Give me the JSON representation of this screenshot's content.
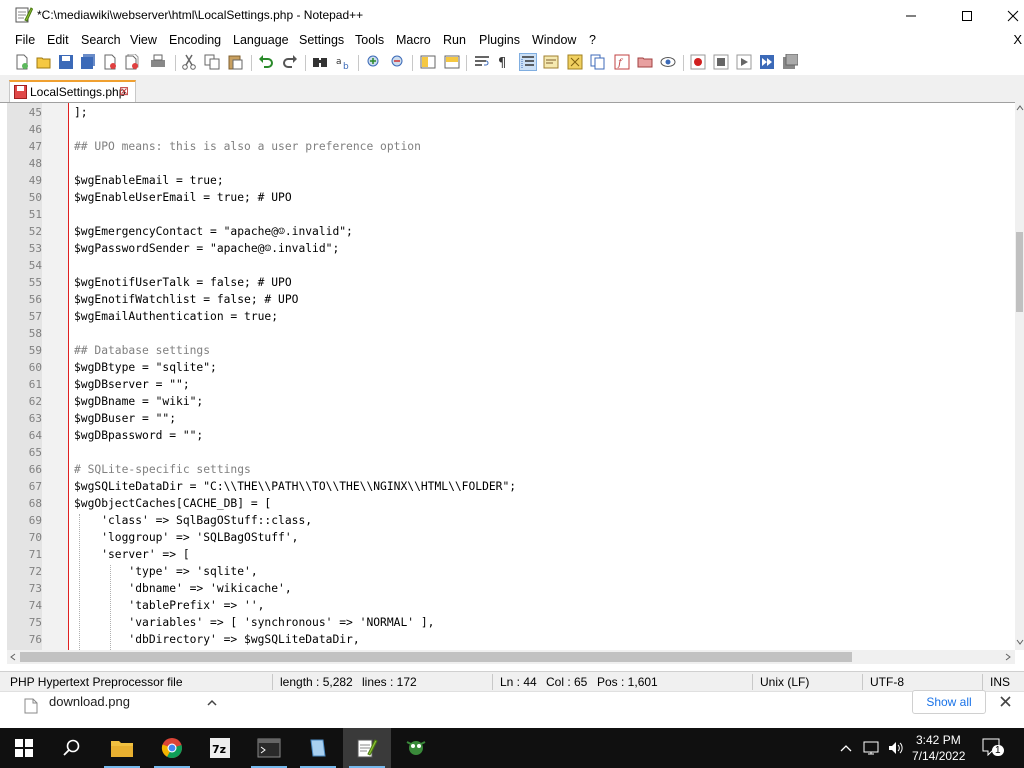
{
  "window": {
    "title": "*C:\\mediawiki\\webserver\\html\\LocalSettings.php - Notepad++"
  },
  "menu": [
    "File",
    "Edit",
    "Search",
    "View",
    "Encoding",
    "Language",
    "Settings",
    "Tools",
    "Macro",
    "Run",
    "Plugins",
    "Window",
    "?"
  ],
  "menu_close": "X",
  "tab": {
    "label": "LocalSettings.php",
    "close": "⊠"
  },
  "code_lines": [
    {
      "n": "45",
      "text": "];"
    },
    {
      "n": "46",
      "text": ""
    },
    {
      "n": "47",
      "text": "## UPO means: this is also a user preference option"
    },
    {
      "n": "48",
      "text": ""
    },
    {
      "n": "49",
      "text": "$wgEnableEmail = true;"
    },
    {
      "n": "50",
      "text": "$wgEnableUserEmail = true; # UPO"
    },
    {
      "n": "51",
      "text": ""
    },
    {
      "n": "52",
      "text": "$wgEmergencyContact = \"apache@☺.invalid\";"
    },
    {
      "n": "53",
      "text": "$wgPasswordSender = \"apache@☺.invalid\";"
    },
    {
      "n": "54",
      "text": ""
    },
    {
      "n": "55",
      "text": "$wgEnotifUserTalk = false; # UPO"
    },
    {
      "n": "56",
      "text": "$wgEnotifWatchlist = false; # UPO"
    },
    {
      "n": "57",
      "text": "$wgEmailAuthentication = true;"
    },
    {
      "n": "58",
      "text": ""
    },
    {
      "n": "59",
      "text": "## Database settings"
    },
    {
      "n": "60",
      "text": "$wgDBtype = \"sqlite\";"
    },
    {
      "n": "61",
      "text": "$wgDBserver = \"\";"
    },
    {
      "n": "62",
      "text": "$wgDBname = \"wiki\";"
    },
    {
      "n": "63",
      "text": "$wgDBuser = \"\";"
    },
    {
      "n": "64",
      "text": "$wgDBpassword = \"\";"
    },
    {
      "n": "65",
      "text": ""
    },
    {
      "n": "66",
      "text": "# SQLite-specific settings"
    },
    {
      "n": "67",
      "text": "$wgSQLiteDataDir = \"C:\\\\THE\\\\PATH\\\\TO\\\\THE\\\\NGINX\\\\HTML\\\\FOLDER\";"
    },
    {
      "n": "68",
      "text": "$wgObjectCaches[CACHE_DB] = ["
    },
    {
      "n": "69",
      "text": "    'class' => SqlBagOStuff::class,"
    },
    {
      "n": "70",
      "text": "    'loggroup' => 'SQLBagOStuff',"
    },
    {
      "n": "71",
      "text": "    'server' => ["
    },
    {
      "n": "72",
      "text": "        'type' => 'sqlite',"
    },
    {
      "n": "73",
      "text": "        'dbname' => 'wikicache',"
    },
    {
      "n": "74",
      "text": "        'tablePrefix' => '',"
    },
    {
      "n": "75",
      "text": "        'variables' => [ 'synchronous' => 'NORMAL' ],"
    },
    {
      "n": "76",
      "text": "        'dbDirectory' => $wgSQLiteDataDir,"
    }
  ],
  "status": {
    "file_type": "PHP Hypertext Preprocessor file",
    "length": "length : 5,282",
    "lines": "lines : 172",
    "ln": "Ln : 44",
    "col": "Col : 65",
    "pos": "Pos : 1,601",
    "eol": "Unix (LF)",
    "encoding": "UTF-8",
    "mode": "INS"
  },
  "downloads": {
    "file": "download.png",
    "show_all": "Show all"
  },
  "taskbar": {
    "apps": [
      "start-icon",
      "search-icon",
      "file-explorer-icon",
      "chrome-icon",
      "7zip-icon",
      "terminal-icon",
      "notepad-icon",
      "notepad-plus-plus-icon",
      "git-icon"
    ],
    "active_app": "notepad-plus-plus-icon",
    "time": "3:42 PM",
    "date": "7/14/2022",
    "notification_count": "1"
  },
  "colors": {
    "accent": "#76b9ed",
    "edge_line": "#e02020",
    "var": "#000080"
  }
}
